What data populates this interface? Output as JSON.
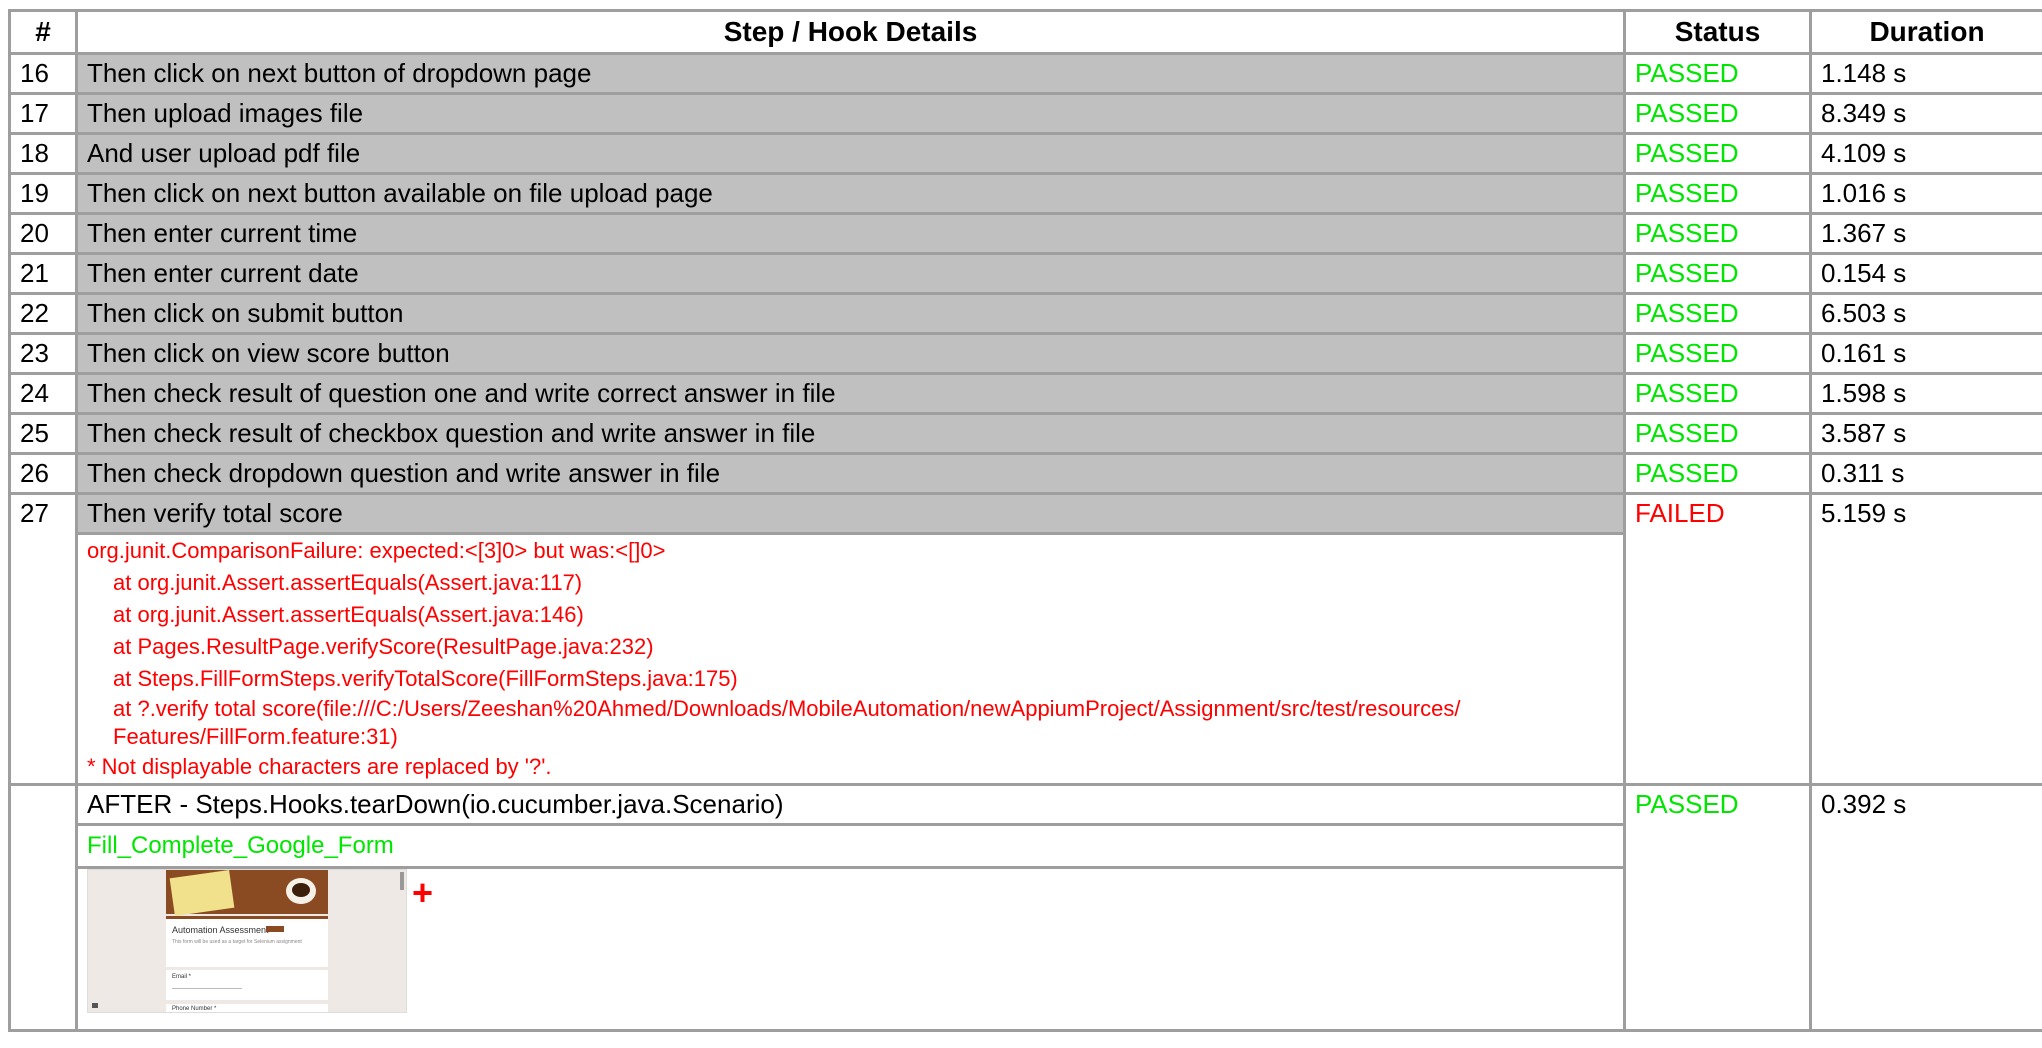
{
  "headers": {
    "num": "#",
    "step": "Step / Hook Details",
    "status": "Status",
    "duration": "Duration"
  },
  "steps": [
    {
      "num": "16",
      "text": "Then click on next button of dropdown page",
      "status": "PASSED",
      "duration": "1.148 s"
    },
    {
      "num": "17",
      "text": "Then upload images file",
      "status": "PASSED",
      "duration": "8.349 s"
    },
    {
      "num": "18",
      "text": "And user upload pdf file",
      "status": "PASSED",
      "duration": "4.109 s"
    },
    {
      "num": "19",
      "text": "Then click on next button available on file upload page",
      "status": "PASSED",
      "duration": "1.016 s"
    },
    {
      "num": "20",
      "text": "Then enter current time",
      "status": "PASSED",
      "duration": "1.367 s"
    },
    {
      "num": "21",
      "text": "Then enter current date",
      "status": "PASSED",
      "duration": "0.154 s"
    },
    {
      "num": "22",
      "text": "Then click on submit button",
      "status": "PASSED",
      "duration": "6.503 s"
    },
    {
      "num": "23",
      "text": "Then click on view score button",
      "status": "PASSED",
      "duration": "0.161 s"
    },
    {
      "num": "24",
      "text": "Then check result of question one and write correct answer in file",
      "status": "PASSED",
      "duration": "1.598 s"
    },
    {
      "num": "25",
      "text": "Then check result of checkbox question and write answer in file",
      "status": "PASSED",
      "duration": "3.587 s"
    },
    {
      "num": "26",
      "text": "Then check dropdown question and write answer in file",
      "status": "PASSED",
      "duration": "0.311 s"
    },
    {
      "num": "27",
      "text": "Then verify total score",
      "status": "FAILED",
      "duration": "5.159 s"
    }
  ],
  "error": {
    "line0": "org.junit.ComparisonFailure: expected:<[3]0> but was:<[]0>",
    "line1": "at org.junit.Assert.assertEquals(Assert.java:117)",
    "line2": "at org.junit.Assert.assertEquals(Assert.java:146)",
    "line3": "at Pages.ResultPage.verifyScore(ResultPage.java:232)",
    "line4": "at Steps.FillFormSteps.verifyTotalScore(FillFormSteps.java:175)",
    "line5": "at ?.verify total score(file:///C:/Users/Zeeshan%20Ahmed/Downloads/MobileAutomation/newAppiumProject/Assignment/src/test/resources/ Features/FillForm.feature:31)",
    "note": "* Not displayable characters are replaced by '?'."
  },
  "hook": {
    "text": "AFTER - Steps.Hooks.tearDown(io.cucumber.java.Scenario)",
    "status": "PASSED",
    "duration": "0.392 s",
    "embed_name": "Fill_Complete_Google_Form",
    "expand_symbol": "+",
    "screenshot": {
      "title": "Automation Assessment",
      "subtitle": "This form will be used as a target for Selenium assignment",
      "field1": "Email *",
      "field2": "Phone Number *"
    }
  },
  "colors": {
    "passed": "#00e600",
    "failed": "#ff0000",
    "step_bg": "#c0c0c0",
    "border": "#9e9e9e"
  }
}
